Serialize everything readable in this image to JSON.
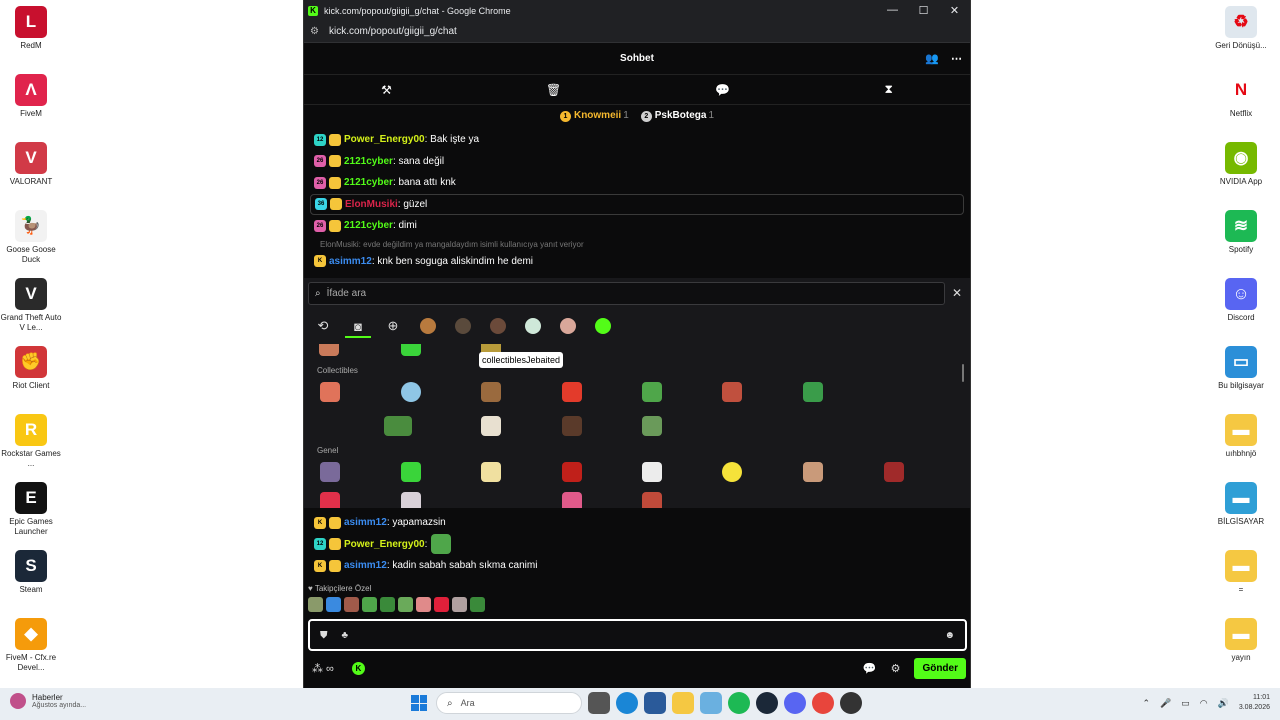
{
  "desktop_left": [
    {
      "label": "RedM",
      "color": "#c8102e",
      "glyph": "L"
    },
    {
      "label": "FiveM",
      "color": "#e0244c",
      "glyph": "Λ"
    },
    {
      "label": "VALORANT",
      "color": "#d13a47",
      "glyph": "V"
    },
    {
      "label": "Goose Goose Duck",
      "color": "#f2f2f2",
      "glyph": "🦆"
    },
    {
      "label": "Grand Theft Auto V Le...",
      "color": "#2a2a2a",
      "glyph": "V"
    },
    {
      "label": "Riot Client",
      "color": "#d13639",
      "glyph": "✊"
    },
    {
      "label": "Rockstar Games ...",
      "color": "#f9c713",
      "glyph": "R"
    },
    {
      "label": "Epic Games Launcher",
      "color": "#121212",
      "glyph": "E"
    },
    {
      "label": "Steam",
      "color": "#1b2838",
      "glyph": "S"
    },
    {
      "label": "FiveM - Cfx.re Devel...",
      "color": "#f59b0b",
      "glyph": "◆"
    }
  ],
  "desktop_right": [
    {
      "label": "Geri Dönüşü...",
      "color": "#dfe7ee",
      "glyph": "♻"
    },
    {
      "label": "Netflix",
      "color": "#ffffff",
      "glyph": "N"
    },
    {
      "label": "NVIDIA App",
      "color": "#76b900",
      "glyph": "◉"
    },
    {
      "label": "Spotify",
      "color": "#1db954",
      "glyph": "≋"
    },
    {
      "label": "Discord",
      "color": "#5865f2",
      "glyph": "☺"
    },
    {
      "label": "Bu bilgisayar",
      "color": "#2b8fd8",
      "glyph": "▭"
    },
    {
      "label": "uıhbhnjö",
      "color": "#f5c842",
      "glyph": "▬"
    },
    {
      "label": "BİLGİSAYAR",
      "color": "#2f9fd6",
      "glyph": "▬"
    },
    {
      "label": "=",
      "color": "#f5c842",
      "glyph": "▬"
    },
    {
      "label": "yayın",
      "color": "#f5c842",
      "glyph": "▬"
    }
  ],
  "window": {
    "title": "kick.com/popout/giigii_g/chat - Google Chrome",
    "url": "kick.com/popout/giigii_g/chat",
    "minimize": "—",
    "maximize": "☐",
    "close": "✕"
  },
  "chat": {
    "title": "Sohbet",
    "pinned": [
      {
        "name": "Knowmeii",
        "count": "1",
        "color": "#f5b82e",
        "rank": "1"
      },
      {
        "name": "PskBotega",
        "count": "1",
        "color": "#cfcfcf",
        "rank": "2"
      }
    ],
    "messages_top": [
      {
        "badge": "12",
        "badge_color": "#2ed3c6",
        "user": "Power_Energy00",
        "user_color": "#d4f11a",
        "text": ": Bak işte ya",
        "highlight": false
      },
      {
        "badge": "26",
        "badge_color": "#e05fa9",
        "user": "2121cyber",
        "user_color": "#53fc18",
        "text": ": sana değil",
        "highlight": false
      },
      {
        "badge": "26",
        "badge_color": "#e05fa9",
        "user": "2121cyber",
        "user_color": "#53fc18",
        "text": ": bana attı knk",
        "highlight": false
      },
      {
        "badge": "36",
        "badge_color": "#3ad6e8",
        "user": "ElonMusiki",
        "user_color": "#d9244a",
        "text": ": güzel",
        "highlight": true
      },
      {
        "badge": "26",
        "badge_color": "#e05fa9",
        "user": "2121cyber",
        "user_color": "#53fc18",
        "text": ": dimi",
        "highlight": false
      }
    ],
    "reply_note": "ElonMusiki: evde değildim ya mangaldaydım isimli kullanıcıya yanıt veriyor",
    "reply_msg": {
      "user": "asimm12",
      "user_color": "#3b8cf0",
      "text": ": knk ben soguga aliskindim he demi"
    },
    "messages_bottom": [
      {
        "badge": "K",
        "badge_color": "#f5c53a",
        "user": "asimm12",
        "user_color": "#3b8cf0",
        "text": ": yapamazsin"
      },
      {
        "badge": "12",
        "badge_color": "#2ed3c6",
        "user": "Power_Energy00",
        "user_color": "#d4f11a",
        "text": ":"
      },
      {
        "badge": "K",
        "badge_color": "#f5c53a",
        "user": "asimm12",
        "user_color": "#3b8cf0",
        "text": ": kadin sabah sabah sıkma canimi"
      }
    ],
    "followers_label": "♥ Takipçilere Özel",
    "send_label": "Gönder"
  },
  "picker": {
    "search_placeholder": "İfade ara",
    "tooltip": "collectiblesJebaited",
    "section_collectibles": "Collectibles",
    "section_general": "Genel",
    "tab_icons": [
      "⟲",
      "◙",
      "⊕"
    ]
  },
  "taskbar": {
    "news_title": "Haberler",
    "news_sub": "Ağustos ayında...",
    "search_placeholder": "Ara",
    "time": "11:01",
    "date": "3.08.2026"
  }
}
